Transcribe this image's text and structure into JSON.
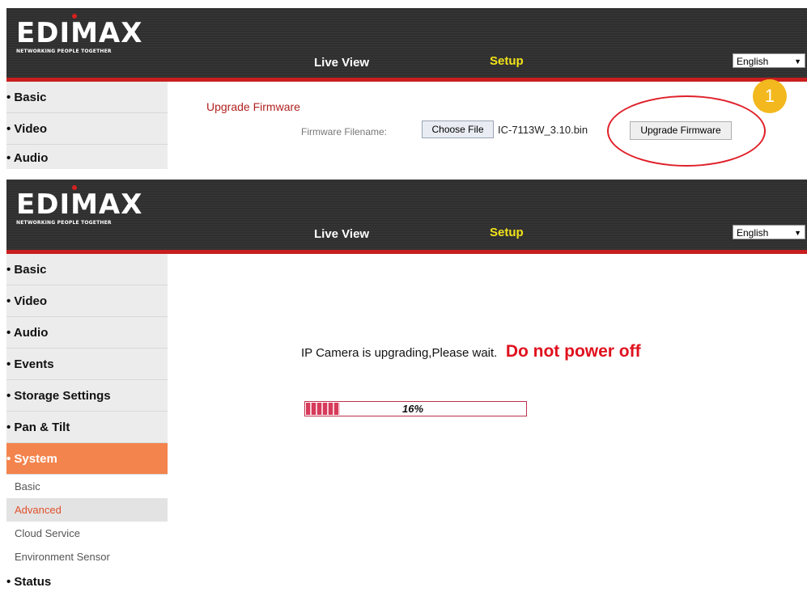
{
  "brand": {
    "name": "EDIMAX",
    "tagline": "NETWORKING PEOPLE TOGETHER"
  },
  "nav": {
    "live_view": "Live View",
    "setup": "Setup",
    "language": "English"
  },
  "top": {
    "sidebar": [
      "Basic",
      "Video",
      "Audio"
    ],
    "section_title": "Upgrade Firmware",
    "filename_label": "Firmware Filename:",
    "choose_file": "Choose File",
    "filename": "IC-7113W_3.10.bin",
    "upgrade_button": "Upgrade Firmware",
    "step_badge": "1",
    "highlight_color": "#e0202a"
  },
  "bottom": {
    "sidebar": [
      "Basic",
      "Video",
      "Audio",
      "Events",
      "Storage Settings",
      "Pan & Tilt",
      "System"
    ],
    "active_item": "System",
    "subitems": [
      "Basic",
      "Advanced",
      "Cloud Service",
      "Environment Sensor"
    ],
    "selected_subitem": "Advanced",
    "after": "Status",
    "message": "IP Camera is upgrading,Please wait.",
    "warning": "Do not power off",
    "progress_label": "16%",
    "progress_percent": 16
  },
  "colors": {
    "accent": "#f4844d",
    "header": "#2f2f2f",
    "red": "#c81e1e",
    "setup": "#f2e31a",
    "badge": "#f2b81d"
  }
}
